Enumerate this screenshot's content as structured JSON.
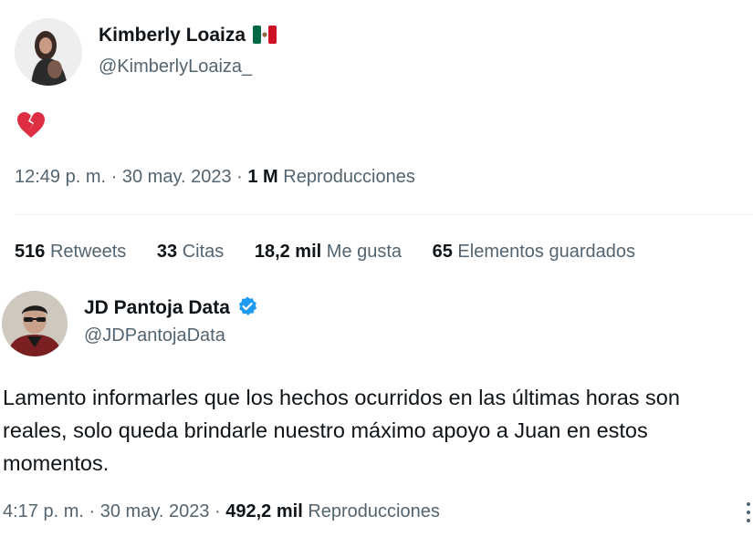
{
  "tweet1": {
    "name": "Kimberly Loaiza",
    "flag_icon": "mexico-flag-icon",
    "handle": "@KimberlyLoaiza_",
    "content_icon": "broken-heart-icon",
    "time": "12:49 p. m.",
    "sep": "·",
    "date": "30 may. 2023",
    "views_count": "1 M",
    "views_label": "Reproducciones",
    "stats": [
      {
        "count": "516",
        "label": "Retweets"
      },
      {
        "count": "33",
        "label": "Citas"
      },
      {
        "count": "18,2 mil",
        "label": "Me gusta"
      },
      {
        "count": "65",
        "label": "Elementos guardados"
      }
    ]
  },
  "tweet2": {
    "name": "JD Pantoja Data",
    "verified_icon": "verified-badge-icon",
    "handle": "@JDPantojaData",
    "text_lines": [
      "Lamento informarles que los hechos ocurridos en las últimas horas son",
      "reales, solo queda brindarle nuestro máximo apoyo a Juan en estos",
      "momentos."
    ],
    "time": "4:17 p. m.",
    "sep": "·",
    "date": "30 may. 2023",
    "views_count": "492,2 mil",
    "views_label": "Reproducciones"
  },
  "colors": {
    "text_primary": "#0f1419",
    "text_secondary": "#536471",
    "verified_blue": "#1d9bf0",
    "heart_red": "#dd2e44",
    "divider": "#eff3f4"
  }
}
